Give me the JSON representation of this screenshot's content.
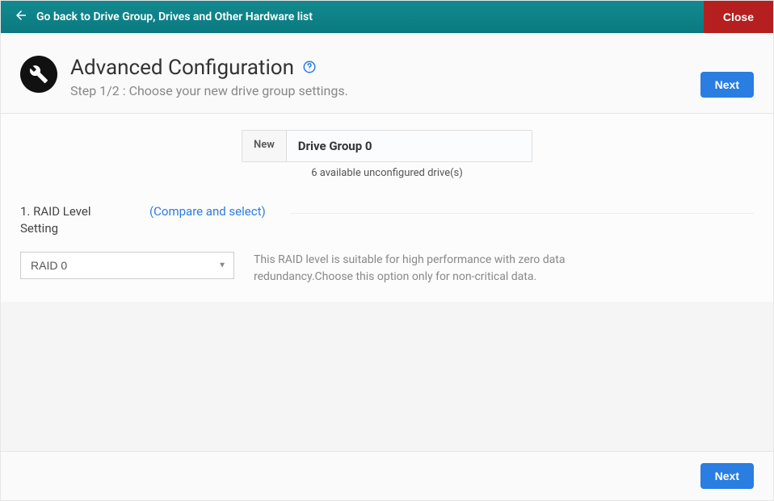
{
  "topbar": {
    "back_label": "Go back to Drive Group, Drives and Other Hardware list",
    "close_label": "Close"
  },
  "header": {
    "title": "Advanced Configuration",
    "step_text": "Step 1/2 : Choose your new drive group settings.",
    "next_label": "Next"
  },
  "drive_group": {
    "badge": "New",
    "name": "Drive Group 0",
    "available_text": "6 available unconfigured drive(s)"
  },
  "raid_section": {
    "title": "1. RAID Level Setting",
    "compare_link": "(Compare and select)",
    "selected_value": "RAID 0",
    "description": "This RAID level is suitable for high performance with zero data redundancy.Choose this option only for non-critical data."
  },
  "footer": {
    "next_label": "Next"
  }
}
